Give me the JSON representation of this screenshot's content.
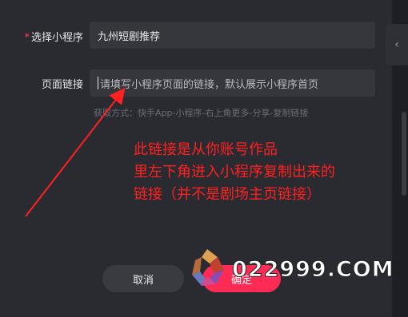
{
  "form": {
    "mini_program_label": "选择小程序",
    "required_mark": "*",
    "mini_program_value": "九州短剧推荐",
    "page_link_label": "页面链接",
    "page_link_placeholder": "请填写小程序页面的链接，默认展示小程序首页",
    "hint": "获取方式：快手App-小程序-右上角更多-分享-复制链接"
  },
  "annotation": {
    "line1": "此链接是从你账号作品",
    "line2": "里左下角进入小程序复制出来的",
    "line3": "链接（并不是剧场主页链接）",
    "color": "#ff2020"
  },
  "buttons": {
    "cancel": "取消",
    "confirm": "确定"
  },
  "side": {
    "chevron": "‹"
  },
  "watermark": {
    "text": "022999.COM"
  },
  "colors": {
    "background": "#2a2b31",
    "field": "#36373d",
    "accent": "#fe2c55"
  }
}
